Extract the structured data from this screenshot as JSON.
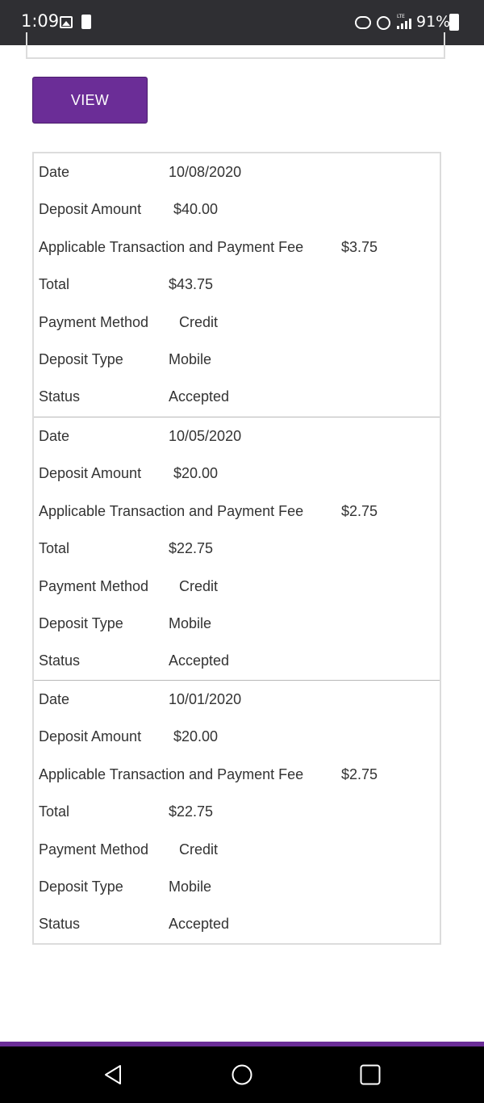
{
  "status_bar": {
    "time": "1:09",
    "battery_percent": "91%",
    "network": "LTE"
  },
  "view_button": {
    "label": "VIEW"
  },
  "labels": {
    "date": "Date",
    "deposit_amount": "Deposit Amount",
    "fee": "Applicable Transaction and Payment Fee",
    "total": "Total",
    "payment_method": "Payment Method",
    "deposit_type": "Deposit Type",
    "status": "Status"
  },
  "records": [
    {
      "date": "10/08/2020",
      "deposit_amount": "$40.00",
      "fee": "$3.75",
      "total": "$43.75",
      "payment_method": "Credit",
      "deposit_type": "Mobile",
      "status": "Accepted"
    },
    {
      "date": "10/05/2020",
      "deposit_amount": "$20.00",
      "fee": "$2.75",
      "total": "$22.75",
      "payment_method": "Credit",
      "deposit_type": "Mobile",
      "status": "Accepted"
    },
    {
      "date": "10/01/2020",
      "deposit_amount": "$20.00",
      "fee": "$2.75",
      "total": "$22.75",
      "payment_method": "Credit",
      "deposit_type": "Mobile",
      "status": "Accepted"
    }
  ],
  "colors": {
    "accent": "#6b2d97",
    "status_bar_bg": "#2f2f33",
    "nav_bar_bg": "#000000",
    "border": "#dcdcdc"
  },
  "icons": {
    "gallery": "image-icon",
    "battery_saver": "battery-saver-icon",
    "volte": "volte-icon",
    "alarm": "alarm-icon",
    "signal": "signal-icon",
    "battery": "battery-icon",
    "back": "back-icon",
    "home": "home-icon",
    "recents": "recents-icon"
  }
}
